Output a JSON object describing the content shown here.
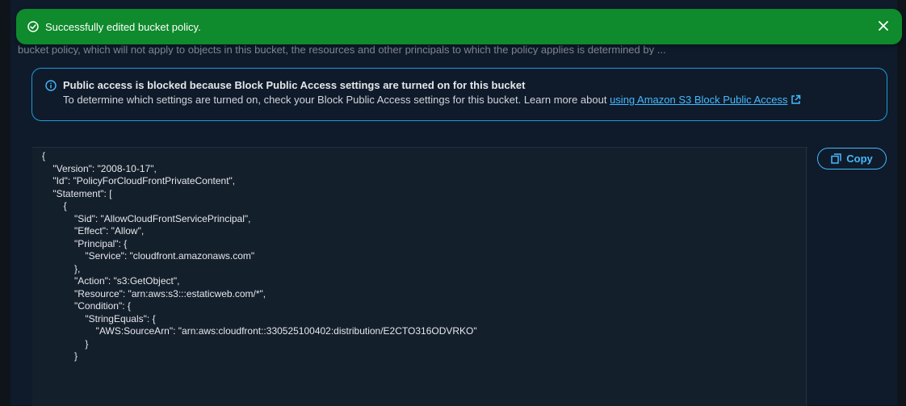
{
  "flash": {
    "message": "Successfully edited bucket policy.",
    "close_label": "✕",
    "color": "#0f8a2d"
  },
  "background_text": "bucket policy, which will not apply to objects in this bucket, the resources and other principals to which the policy applies is determined by ...",
  "info": {
    "title": "Public access is blocked because Block Public Access settings are turned on for this bucket",
    "text": "To determine which settings are turned on, check your Block Public Access settings for this bucket. Learn more about ",
    "link": "using Amazon S3 Block Public Access"
  },
  "copy": {
    "label": "Copy"
  },
  "policy_lines": [
    "{",
    "    \"Version\": \"2008-10-17\",",
    "    \"Id\": \"PolicyForCloudFrontPrivateContent\",",
    "    \"Statement\": [",
    "        {",
    "            \"Sid\": \"AllowCloudFrontServicePrincipal\",",
    "            \"Effect\": \"Allow\",",
    "            \"Principal\": {",
    "                \"Service\": \"cloudfront.amazonaws.com\"",
    "            },",
    "            \"Action\": \"s3:GetObject\",",
    "            \"Resource\": \"arn:aws:s3:::estaticweb.com/*\",",
    "            \"Condition\": {",
    "                \"StringEquals\": {",
    "                    \"AWS:SourceArn\": \"arn:aws:cloudfront::330525100402:distribution/E2CTO316ODVRKO\"",
    "                }",
    "            }"
  ],
  "colors": {
    "accent": "#44b9ff",
    "info_border": "#1e9ae0",
    "background": "#0f1b2a"
  }
}
